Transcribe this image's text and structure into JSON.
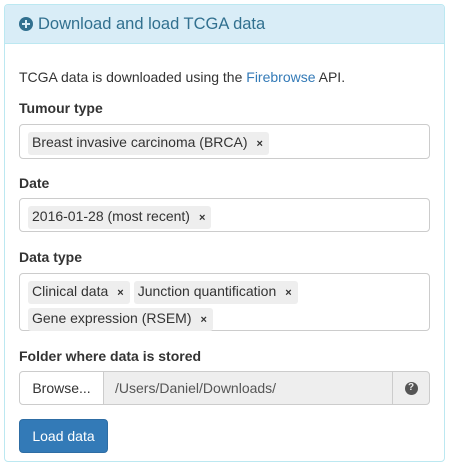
{
  "panel": {
    "title": "Download and load TCGA data",
    "icon": "plus-circle-icon"
  },
  "intro": {
    "prefix": "TCGA data is downloaded using the ",
    "link": "Firebrowse",
    "suffix": " API."
  },
  "tumour_type": {
    "label": "Tumour type",
    "selected": [
      "Breast invasive carcinoma (BRCA)"
    ]
  },
  "date": {
    "label": "Date",
    "selected": [
      "2016-01-28 (most recent)"
    ]
  },
  "data_type": {
    "label": "Data type",
    "selected": [
      "Clinical data",
      "Junction quantification",
      "Gene expression (RSEM)"
    ]
  },
  "folder": {
    "label": "Folder where data is stored",
    "browse_label": "Browse...",
    "path": "/Users/Daniel/Downloads/",
    "help_icon": "question-circle-icon"
  },
  "load_button": {
    "label": "Load data"
  },
  "remove_symbol": "×",
  "help_symbol": "?",
  "colors": {
    "heading_bg": "#d9edf7",
    "heading_text": "#31708f",
    "primary": "#337ab7",
    "link": "#337ab7"
  }
}
